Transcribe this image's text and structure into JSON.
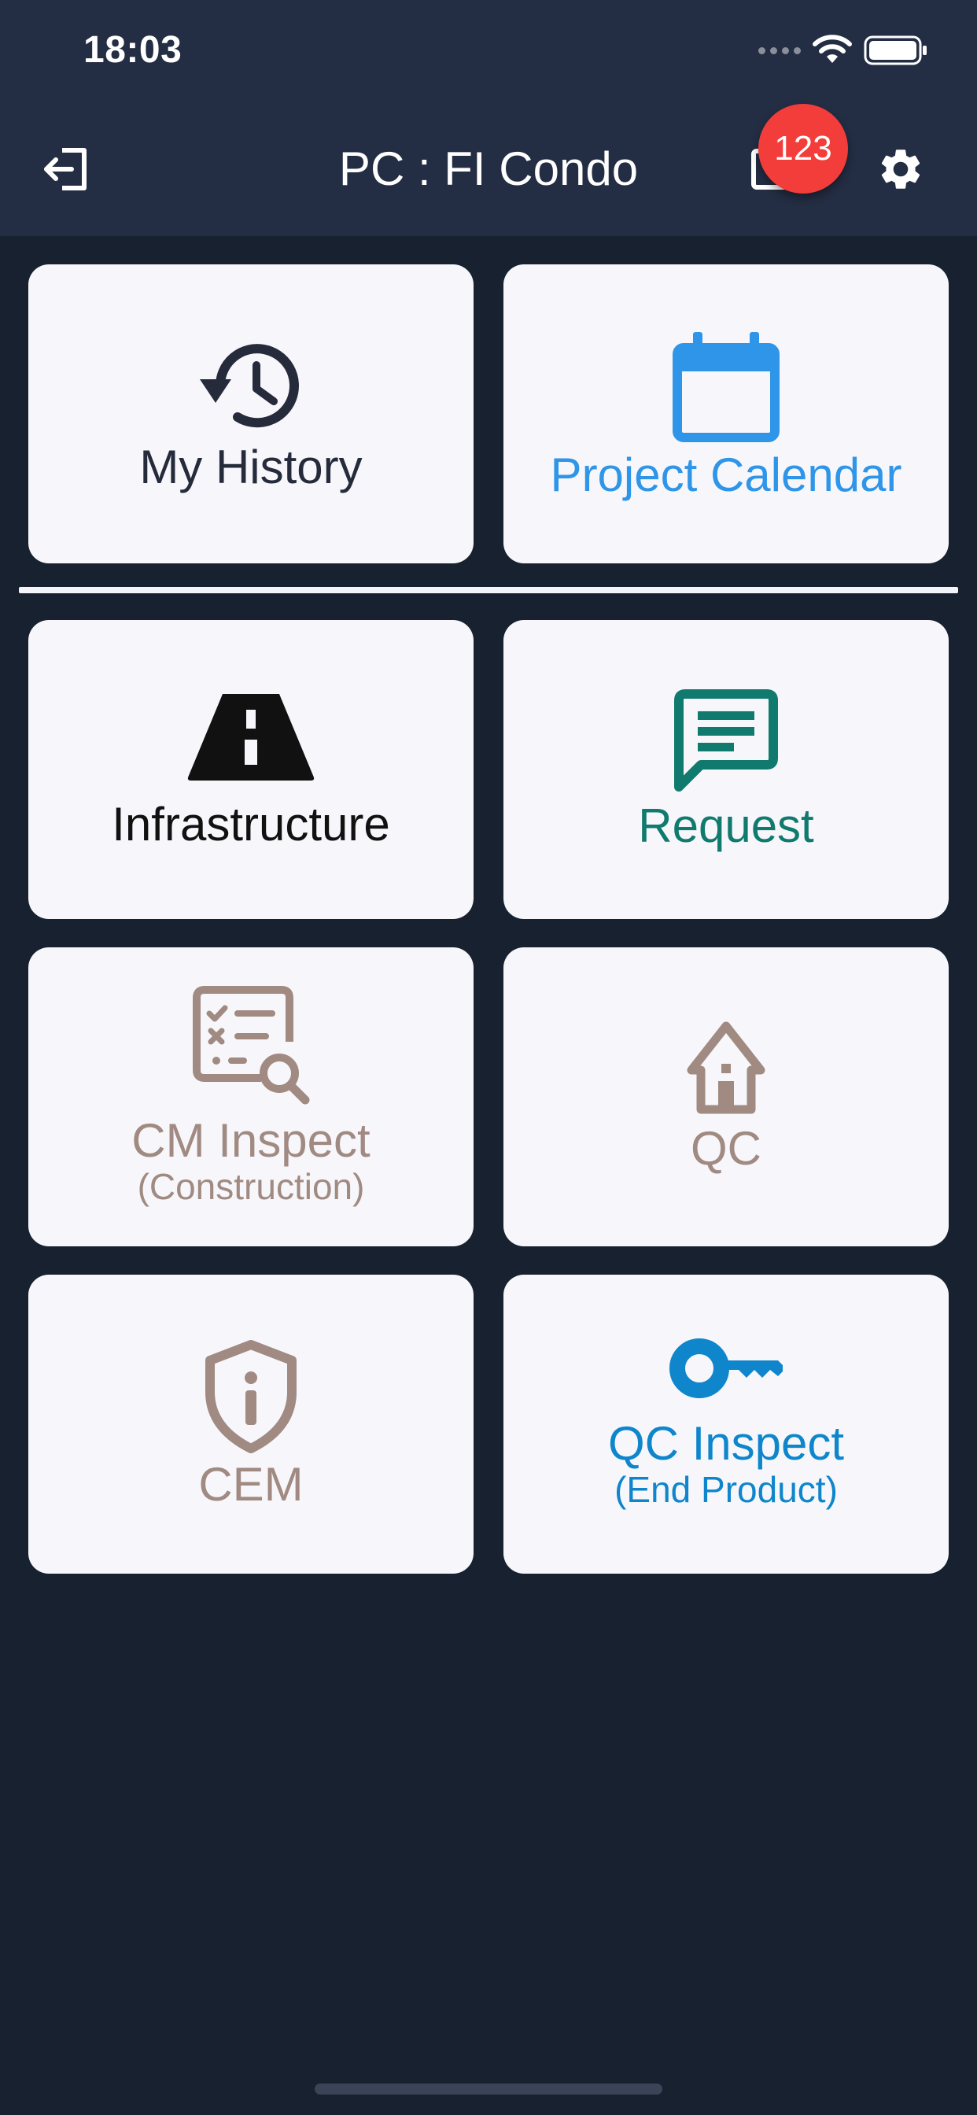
{
  "status_bar": {
    "time": "18:03"
  },
  "header": {
    "title": "PC : FI Condo",
    "notification_count": "123"
  },
  "tiles": {
    "my_history": {
      "label": "My History",
      "color": "#252b3b"
    },
    "project_calendar": {
      "label": "Project Calendar",
      "color": "#2f95e8"
    },
    "infrastructure": {
      "label": "Infrastructure",
      "color": "#111111"
    },
    "request": {
      "label": "Request",
      "color": "#117a6e"
    },
    "cm_inspect": {
      "label": "CM Inspect",
      "sublabel": "(Construction)",
      "color": "#a08a82"
    },
    "qc": {
      "label": "QC",
      "color": "#a08a82"
    },
    "cem": {
      "label": "CEM",
      "color": "#a08a82"
    },
    "qc_inspect": {
      "label": "QC Inspect",
      "sublabel": "(End Product)",
      "color": "#0f86cc"
    }
  },
  "icons": {
    "exit": "exit-icon",
    "inbox": "inbox-icon",
    "settings": "gear-icon",
    "history": "history-icon",
    "calendar": "calendar-icon",
    "road": "road-icon",
    "message": "message-icon",
    "checklist_search": "checklist-search-icon",
    "house": "house-icon",
    "shield_info": "shield-info-icon",
    "key": "key-icon"
  }
}
